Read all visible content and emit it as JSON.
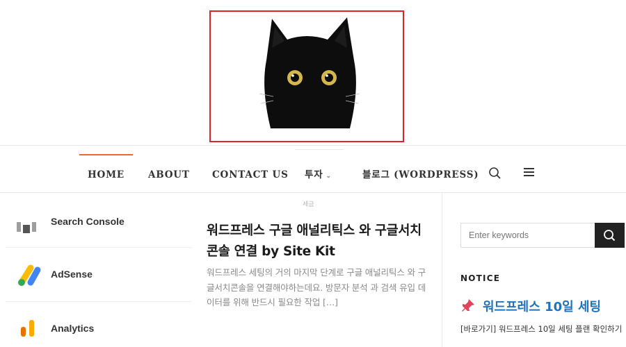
{
  "header": {
    "logo_alt": "black-cat-logo"
  },
  "nav": {
    "items": [
      {
        "label": "HOME",
        "active": true
      },
      {
        "label": "ABOUT"
      },
      {
        "label": "CONTACT US"
      },
      {
        "label": "투자",
        "has_dropdown": true
      },
      {
        "label": "블로그 (WORDPRESS)"
      }
    ],
    "icons": [
      "search-icon",
      "menu-icon"
    ]
  },
  "category_label": "세금",
  "left_tools": [
    {
      "label": "Search Console"
    },
    {
      "label": "AdSense"
    },
    {
      "label": "Analytics"
    }
  ],
  "post": {
    "title": "워드프레스 구글 애널리틱스 와 구글서치콘솔 연결 by Site Kit",
    "excerpt": "워드프레스 세팅의 거의 마지막 단계로 구글 애널리틱스 와 구글서치콘솔을 연결해야하는데요. 방문자 분석 과 검색 유입 데이터를 위해 반드시 필요한 작업 […]"
  },
  "sidebar": {
    "search_placeholder": "Enter keywords",
    "notice_heading": "NOTICE",
    "notice_title": "워드프레스 10일 세팅",
    "notice_link": "[바로가기] 워드프레스 10일 세팅 플랜 확인하기"
  },
  "colors": {
    "accent": "#e9653e",
    "link": "#1e73be",
    "logo_border": "#e0202a"
  }
}
